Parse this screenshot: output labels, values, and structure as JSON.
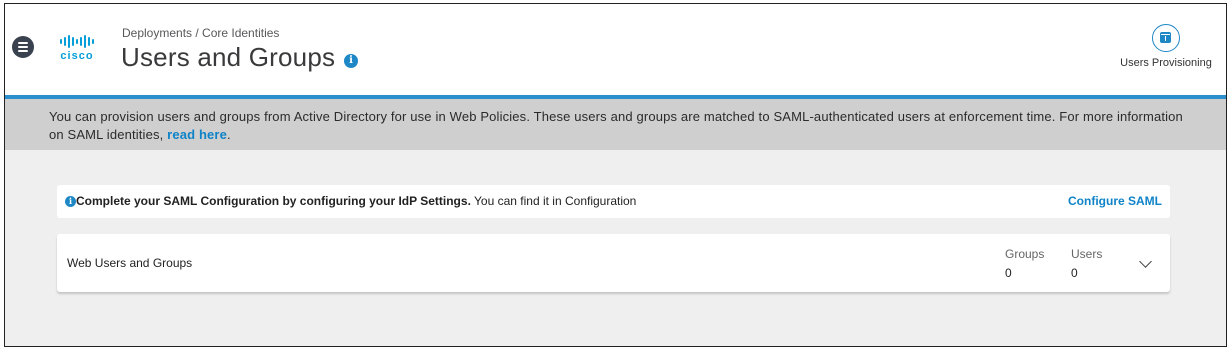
{
  "header": {
    "breadcrumb": "Deployments / Core Identities",
    "title": "Users and Groups",
    "logo_text": "cisco",
    "provisioning_label": "Users Provisioning"
  },
  "banner": {
    "text": "You can provision users and groups from Active Directory for use in Web Policies. These users and groups are matched to SAML-authenticated users at enforcement time. For more information on SAML identities, ",
    "link_label": "read here",
    "suffix": "."
  },
  "notice": {
    "bold_text": "Complete your SAML Configuration by configuring your IdP Settings.",
    "text": " You can find it in Configuration",
    "action_label": "Configure SAML"
  },
  "web_users_groups": {
    "title": "Web Users and Groups",
    "groups_label": "Groups",
    "groups_value": "0",
    "users_label": "Users",
    "users_value": "0"
  },
  "colors": {
    "accent": "#1e88c7",
    "link": "#0f83c8",
    "banner_bg": "#cfcfcf",
    "page_bg": "#efefef"
  },
  "icons": [
    "menu-icon",
    "cisco-logo",
    "info-icon",
    "user-provisioning-icon",
    "chevron-down-icon"
  ]
}
